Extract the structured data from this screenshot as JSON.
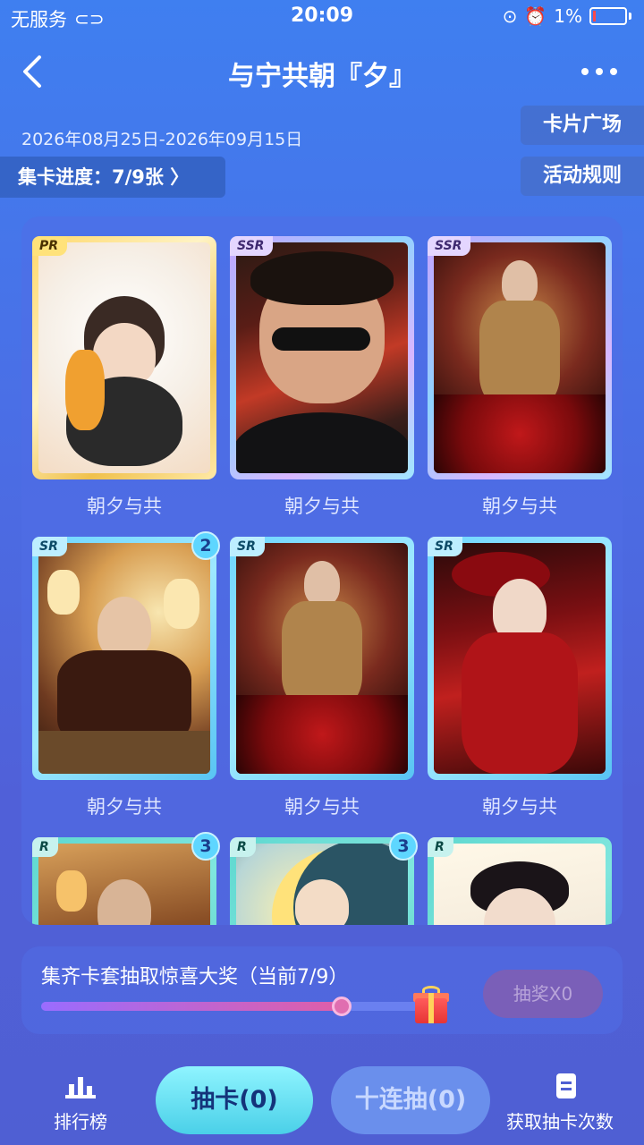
{
  "status_bar": {
    "carrier": "无服务",
    "time": "20:09",
    "battery": "1%"
  },
  "header": {
    "title": "与宁共朝『夕』",
    "dates": "2026年08月25日-2026年09月15日",
    "card_plaza": "卡片广场",
    "rules": "活动规则",
    "progress": "集卡进度：7/9张 〉"
  },
  "cards": [
    {
      "rarity": "PR",
      "label": "朝夕与共",
      "count": ""
    },
    {
      "rarity": "SSR",
      "label": "朝夕与共",
      "count": ""
    },
    {
      "rarity": "SSR",
      "label": "朝夕与共",
      "count": ""
    },
    {
      "rarity": "SR",
      "label": "朝夕与共",
      "count": "2"
    },
    {
      "rarity": "SR",
      "label": "朝夕与共",
      "count": ""
    },
    {
      "rarity": "SR",
      "label": "朝夕与共",
      "count": ""
    },
    {
      "rarity": "R",
      "label": "",
      "count": "3"
    },
    {
      "rarity": "R",
      "label": "",
      "count": "3"
    },
    {
      "rarity": "R",
      "label": "",
      "count": ""
    }
  ],
  "prize": {
    "text": "集齐卡套抽取惊喜大奖（当前7/9）",
    "progress_fraction": 0.778,
    "button": "抽奖X0"
  },
  "bottom_nav": {
    "rank_label": "排行榜",
    "draw_one": "抽卡(0)",
    "draw_ten": "十连抽(0)",
    "get_more": "获取抽卡次数"
  },
  "colors": {
    "background": "#4a6fe6",
    "accent_cyan": "#4ad0e8",
    "prize_fill": "#e05ea8"
  }
}
